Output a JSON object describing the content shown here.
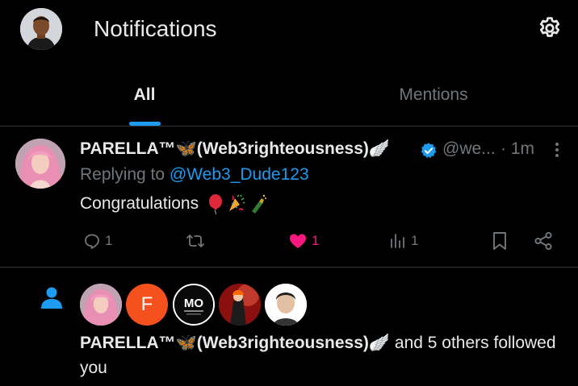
{
  "header": {
    "title": "Notifications",
    "icons": {
      "settings": "gear-icon"
    }
  },
  "tabs": [
    {
      "label": "All",
      "active": true
    },
    {
      "label": "Mentions",
      "active": false
    }
  ],
  "colors": {
    "accent": "#1d9bf0",
    "like": "#f91880",
    "muted": "#71767b",
    "text": "#e7e9ea"
  },
  "post": {
    "author_name": "PARELLA™🦋(Web3righteousness)🪽",
    "handle": "@we...",
    "time": "· 1m",
    "replying_prefix": "Replying to",
    "replying_to": "@Web3_Dude123",
    "text": "Congratulations",
    "emojis": [
      "balloon",
      "confetti",
      "champagne"
    ],
    "actions": {
      "replies": "1",
      "reposts": "",
      "likes": "1",
      "liked": true,
      "views": "1"
    }
  },
  "follow_notification": {
    "avatars": [
      "avatar-parella",
      "F",
      "MO",
      "avatar-red",
      "avatar-person"
    ],
    "name": "PARELLA™🦋(Web3righteousness)🪽",
    "rest": " and 5 others followed you"
  }
}
